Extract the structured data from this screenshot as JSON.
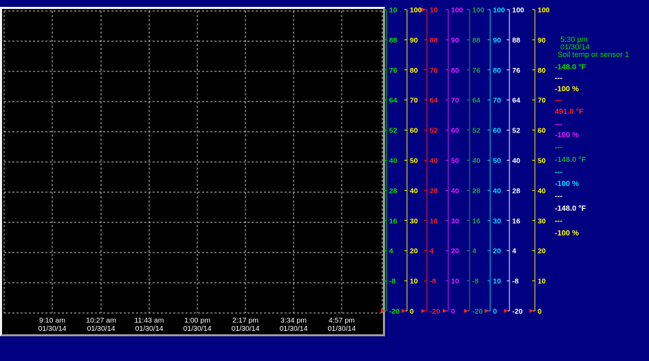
{
  "colors": {
    "background": "#000080",
    "plot_bg": "#000000",
    "grid": "#d0d0d0",
    "green": "#00e000",
    "yellow": "#ffff00",
    "red": "#ff2020",
    "magenta": "#e020ff",
    "dark_green": "#20a040",
    "cyan": "#00e0ff",
    "white": "#ffffff"
  },
  "time_axis": [
    {
      "time": "9:10 am",
      "date": "01/30/14"
    },
    {
      "time": "10:27 am",
      "date": "01/30/14"
    },
    {
      "time": "11:43 am",
      "date": "01/30/14"
    },
    {
      "time": "1:00 pm",
      "date": "01/30/14"
    },
    {
      "time": "2:17 pm",
      "date": "01/30/14"
    },
    {
      "time": "3:34 pm",
      "date": "01/30/14"
    },
    {
      "time": "4:57 pm",
      "date": "01/30/14"
    }
  ],
  "axes": [
    {
      "id": "axis-1",
      "color": "green",
      "labels": [
        "10",
        "88",
        "76",
        "64",
        "52",
        "40",
        "28",
        "16",
        "4",
        "-8",
        "-20"
      ],
      "marker_top": false
    },
    {
      "id": "axis-2",
      "color": "yellow",
      "labels": [
        "100",
        "90",
        "80",
        "70",
        "60",
        "50",
        "40",
        "30",
        "20",
        "10",
        "0"
      ],
      "marker_top": false
    },
    {
      "id": "axis-3",
      "color": "red",
      "labels": [
        "10",
        "88",
        "76",
        "64",
        "52",
        "40",
        "28",
        "16",
        "4",
        "-8",
        "-20"
      ],
      "marker_top": true
    },
    {
      "id": "axis-4",
      "color": "magenta",
      "labels": [
        "100",
        "90",
        "80",
        "70",
        "60",
        "50",
        "40",
        "30",
        "20",
        "10",
        "0"
      ],
      "marker_top": false
    },
    {
      "id": "axis-5",
      "color": "dark_green",
      "labels": [
        "100",
        "88",
        "76",
        "64",
        "52",
        "40",
        "28",
        "16",
        "4",
        "-8",
        "-20"
      ],
      "marker_top": false
    },
    {
      "id": "axis-6",
      "color": "cyan",
      "labels": [
        "100",
        "90",
        "80",
        "70",
        "60",
        "50",
        "40",
        "30",
        "20",
        "10",
        "0"
      ],
      "marker_top": false
    },
    {
      "id": "axis-7",
      "color": "white",
      "labels": [
        "100",
        "88",
        "76",
        "64",
        "52",
        "40",
        "28",
        "16",
        "4",
        "-8",
        "-20"
      ],
      "marker_top": false
    },
    {
      "id": "axis-8",
      "color": "yellow",
      "labels": [
        "100",
        "90",
        "80",
        "70",
        "60",
        "50",
        "40",
        "30",
        "20",
        "10",
        "0"
      ],
      "marker_top": false
    }
  ],
  "readout": {
    "time": "5:30 pm",
    "date": "01/30/14",
    "sensor": "Soil temp or sensor 1",
    "lines": [
      {
        "text": "-148.0 °F",
        "color": "green"
      },
      {
        "text": "---",
        "color": "white"
      },
      {
        "text": "-100 %",
        "color": "yellow"
      },
      {
        "text": "---",
        "color": "red"
      },
      {
        "text": "491.0 °F",
        "color": "red"
      },
      {
        "text": "---",
        "color": "magenta"
      },
      {
        "text": "-100 %",
        "color": "magenta"
      },
      {
        "text": "---",
        "color": "dark_green"
      },
      {
        "text": "-148.0 °F",
        "color": "dark_green"
      },
      {
        "text": "---",
        "color": "cyan"
      },
      {
        "text": "-100 %",
        "color": "cyan"
      },
      {
        "text": "---",
        "color": "white"
      },
      {
        "text": "-148.0 °F",
        "color": "white"
      },
      {
        "text": "---",
        "color": "yellow"
      },
      {
        "text": "-100 %",
        "color": "yellow"
      }
    ]
  }
}
